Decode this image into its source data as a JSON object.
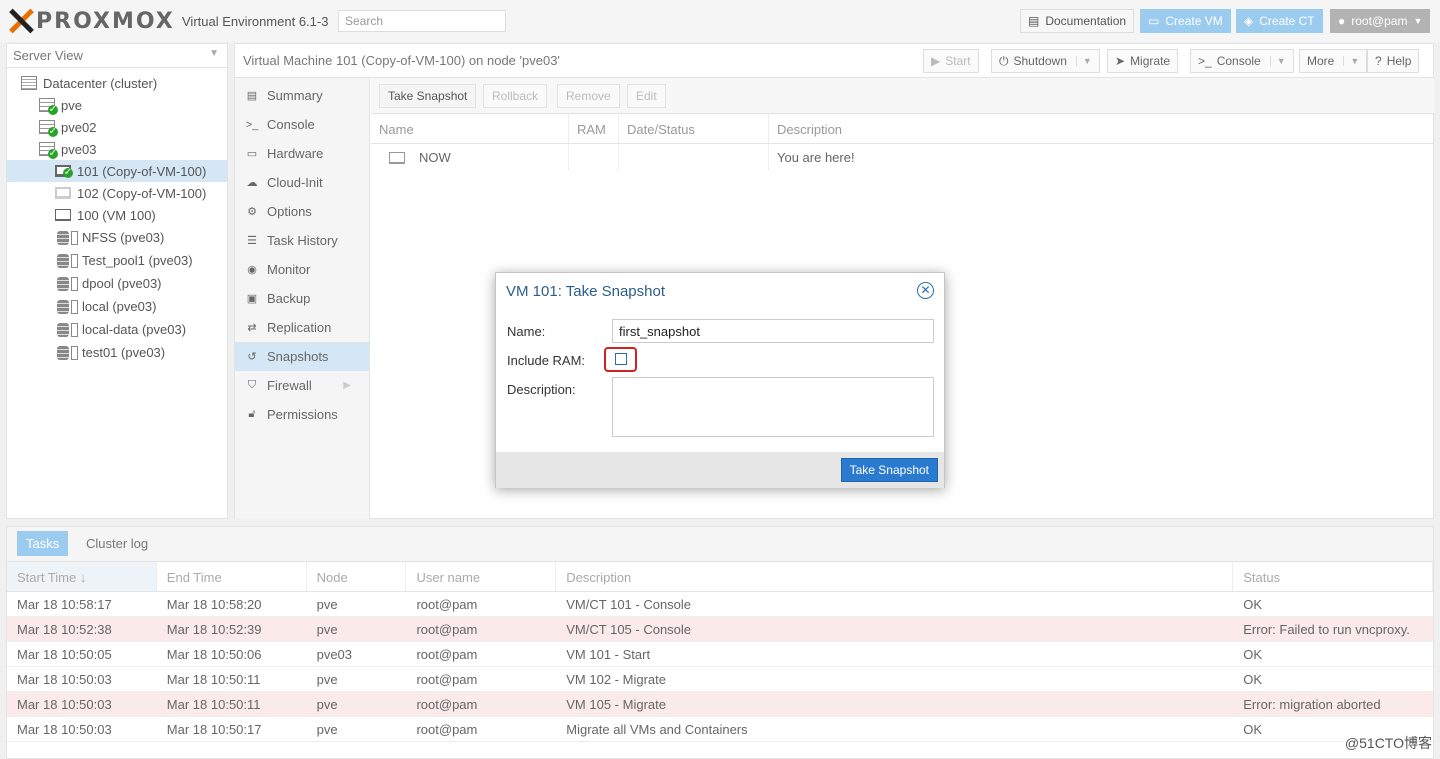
{
  "header": {
    "logo_text": "PROXMOX",
    "version": "Virtual Environment 6.1-3",
    "search_placeholder": "Search",
    "documentation": "Documentation",
    "create_vm": "Create VM",
    "create_ct": "Create CT",
    "user": "root@pam"
  },
  "tree": {
    "view_label": "Server View",
    "items": [
      {
        "label": "Datacenter (cluster)"
      },
      {
        "label": "pve"
      },
      {
        "label": "pve02"
      },
      {
        "label": "pve03"
      },
      {
        "label": "101 (Copy-of-VM-100)"
      },
      {
        "label": "102 (Copy-of-VM-100)"
      },
      {
        "label": "100 (VM 100)"
      },
      {
        "label": "NFSS (pve03)"
      },
      {
        "label": "Test_pool1 (pve03)"
      },
      {
        "label": "dpool (pve03)"
      },
      {
        "label": "local (pve03)"
      },
      {
        "label": "local-data (pve03)"
      },
      {
        "label": "test01 (pve03)"
      }
    ]
  },
  "content": {
    "title": "Virtual Machine 101 (Copy-of-VM-100) on node 'pve03'",
    "actions": {
      "start": "Start",
      "shutdown": "Shutdown",
      "migrate": "Migrate",
      "console": "Console",
      "more": "More",
      "help": "Help"
    },
    "nav": [
      {
        "label": "Summary"
      },
      {
        "label": "Console"
      },
      {
        "label": "Hardware"
      },
      {
        "label": "Cloud-Init"
      },
      {
        "label": "Options"
      },
      {
        "label": "Task History"
      },
      {
        "label": "Monitor"
      },
      {
        "label": "Backup"
      },
      {
        "label": "Replication"
      },
      {
        "label": "Snapshots"
      },
      {
        "label": "Firewall"
      },
      {
        "label": "Permissions"
      }
    ],
    "snapshot_toolbar": {
      "take": "Take Snapshot",
      "rollback": "Rollback",
      "remove": "Remove",
      "edit": "Edit"
    },
    "grid": {
      "columns": [
        "Name",
        "RAM",
        "Date/Status",
        "Description"
      ],
      "rows": [
        {
          "name": "NOW",
          "ram": "",
          "date": "",
          "description": "You are here!"
        }
      ]
    }
  },
  "modal": {
    "title": "VM 101: Take Snapshot",
    "name_label": "Name:",
    "name_value": "first_snapshot",
    "ram_label": "Include RAM:",
    "ram_checked": false,
    "description_label": "Description:",
    "description_value": "",
    "submit": "Take Snapshot"
  },
  "tasks": {
    "tabs": [
      "Tasks",
      "Cluster log"
    ],
    "columns": [
      "Start Time",
      "End Time",
      "Node",
      "User name",
      "Description",
      "Status"
    ],
    "rows": [
      {
        "start": "Mar 18 10:58:17",
        "end": "Mar 18 10:58:20",
        "node": "pve",
        "user": "root@pam",
        "desc": "VM/CT 101 - Console",
        "status": "OK"
      },
      {
        "start": "Mar 18 10:52:38",
        "end": "Mar 18 10:52:39",
        "node": "pve",
        "user": "root@pam",
        "desc": "VM/CT 105 - Console",
        "status": "Error: Failed to run vncproxy."
      },
      {
        "start": "Mar 18 10:50:05",
        "end": "Mar 18 10:50:06",
        "node": "pve03",
        "user": "root@pam",
        "desc": "VM 101 - Start",
        "status": "OK"
      },
      {
        "start": "Mar 18 10:50:03",
        "end": "Mar 18 10:50:11",
        "node": "pve",
        "user": "root@pam",
        "desc": "VM 102 - Migrate",
        "status": "OK"
      },
      {
        "start": "Mar 18 10:50:03",
        "end": "Mar 18 10:50:11",
        "node": "pve",
        "user": "root@pam",
        "desc": "VM 105 - Migrate",
        "status": "Error: migration aborted"
      },
      {
        "start": "Mar 18 10:50:03",
        "end": "Mar 18 10:50:17",
        "node": "pve",
        "user": "root@pam",
        "desc": "Migrate all VMs and Containers",
        "status": "OK"
      }
    ]
  },
  "watermark": "@51CTO博客"
}
